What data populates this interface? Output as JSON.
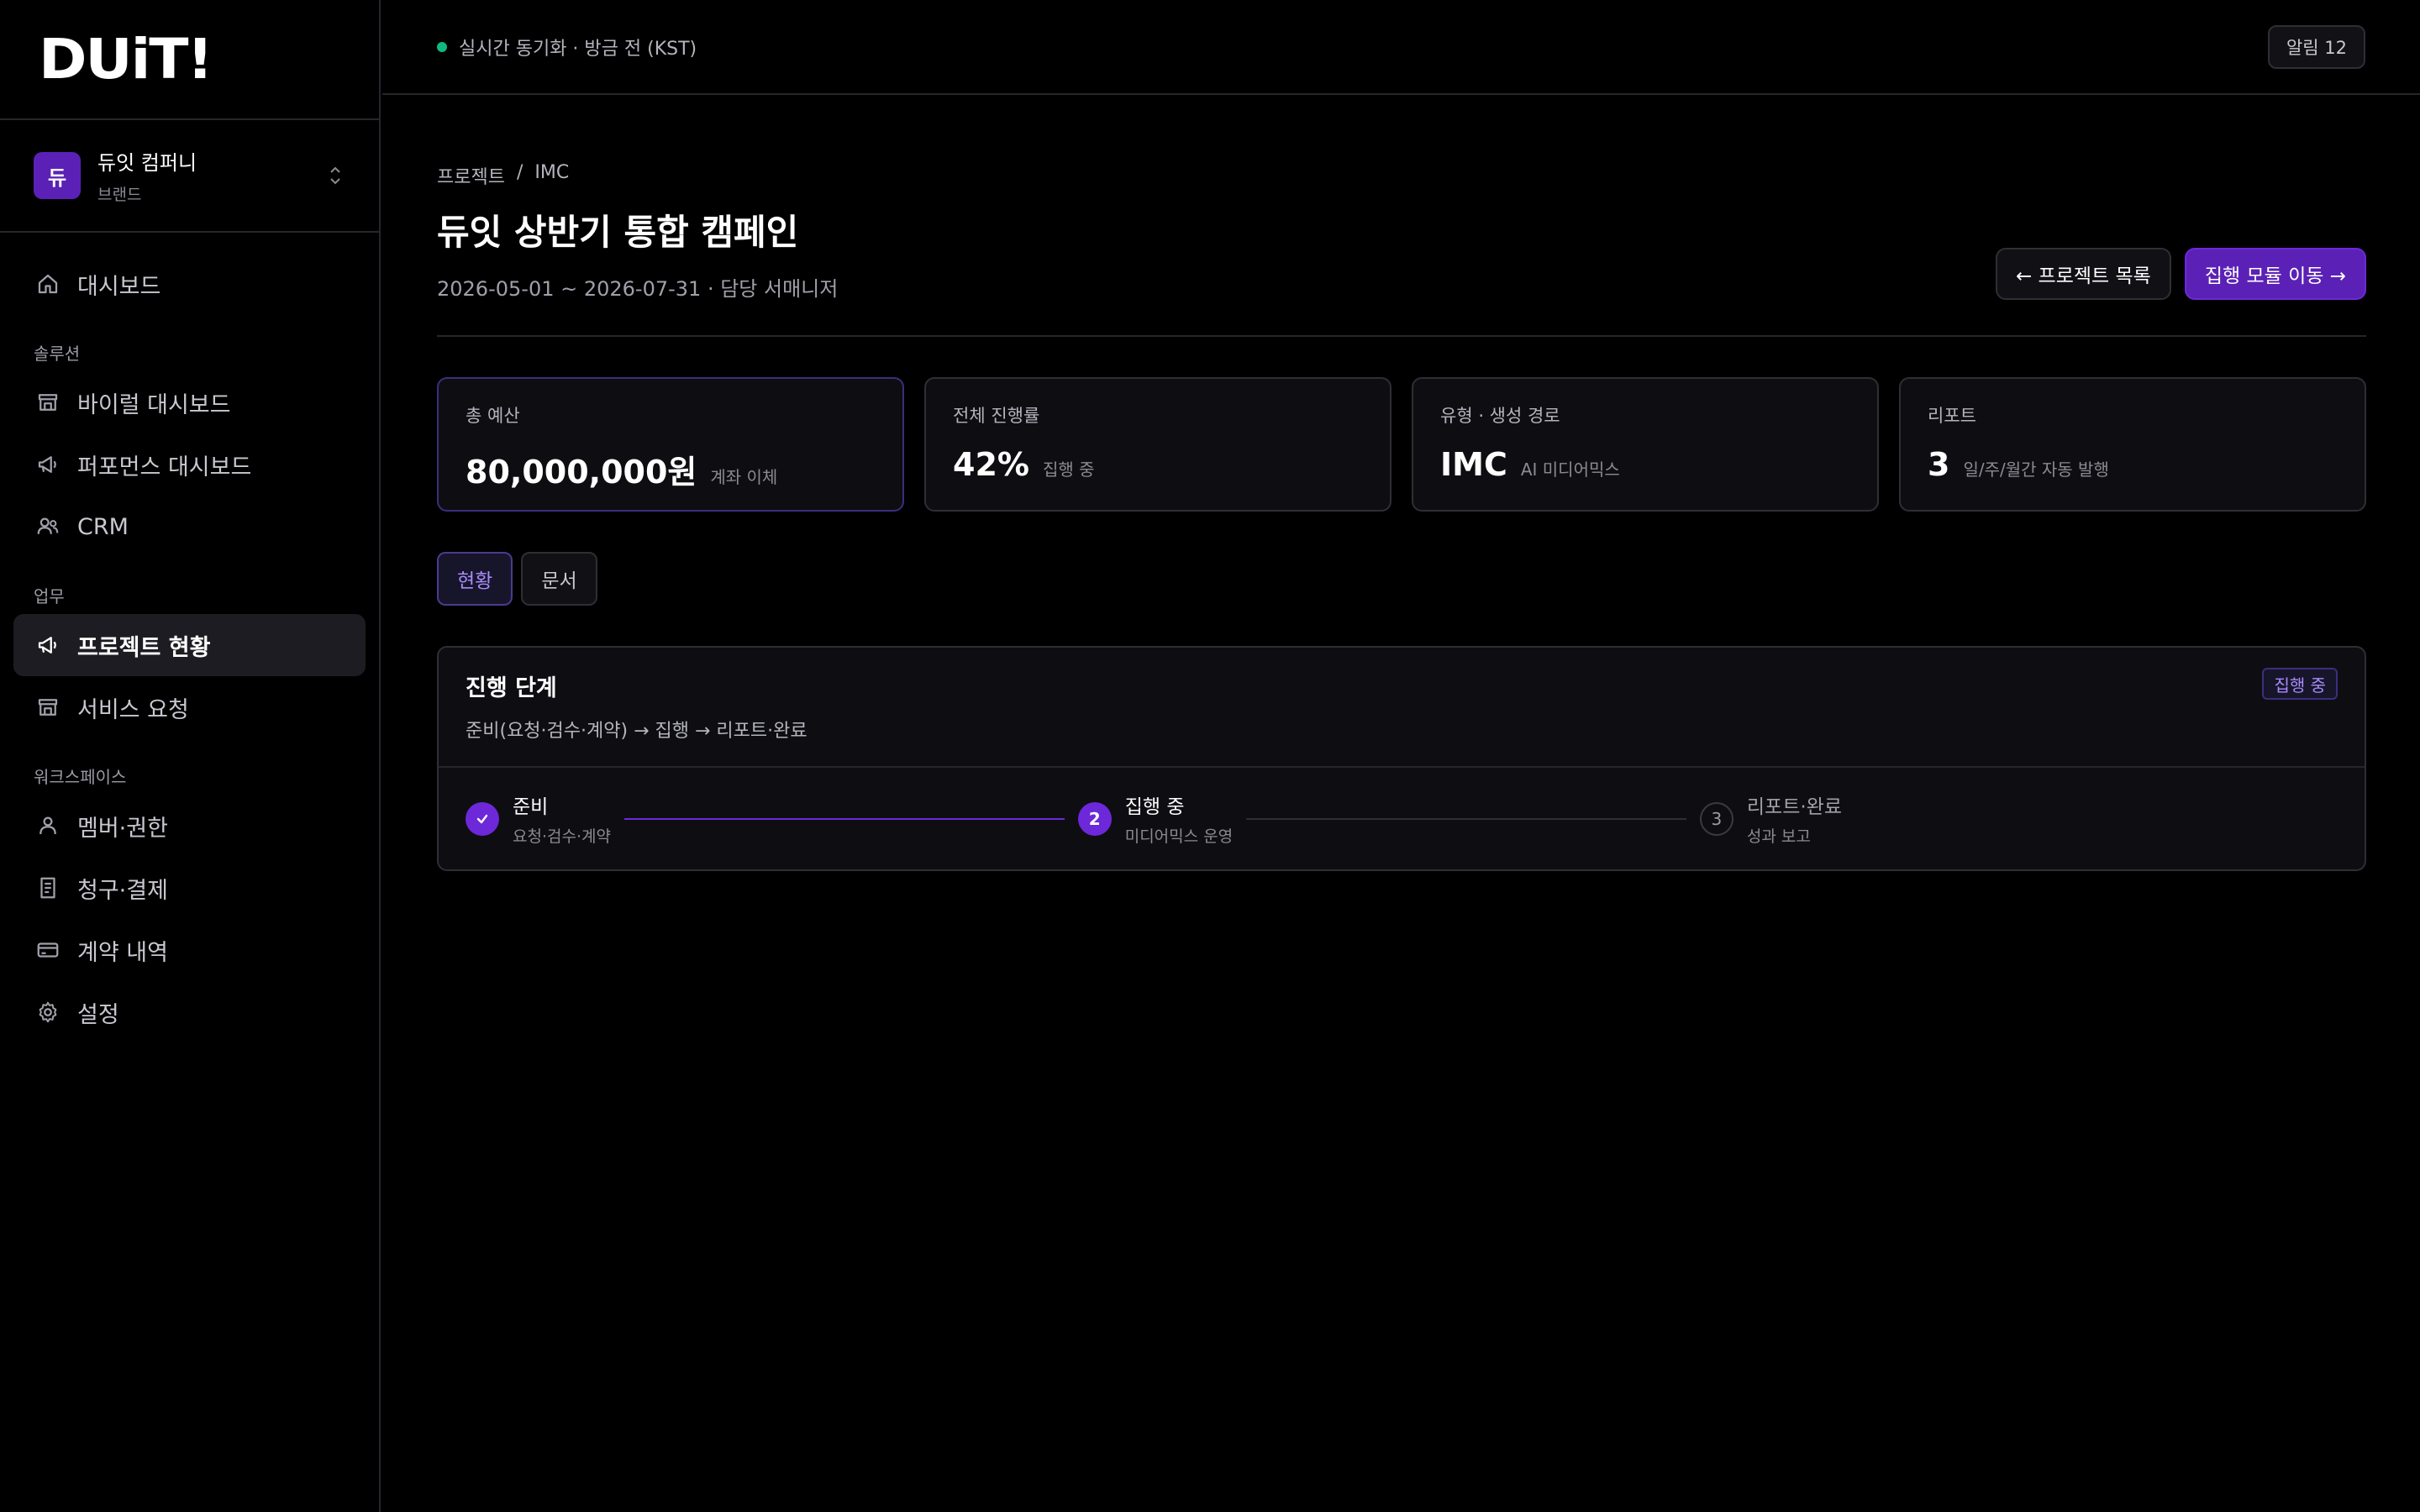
{
  "brand": {
    "logo": "DUiT!"
  },
  "company": {
    "avatar": "듀",
    "name": "듀잇 컴퍼니",
    "type": "브랜드"
  },
  "sidebar": {
    "dashboard": "대시보드",
    "sections": {
      "solution": "솔루션",
      "work": "업무",
      "workspace": "워크스페이스"
    },
    "items": {
      "viral": "바이럴 대시보드",
      "performance": "퍼포먼스 대시보드",
      "crm": "CRM",
      "project_status": "프로젝트 현황",
      "service_request": "서비스 요청",
      "members": "멤버·권한",
      "billing": "청구·결제",
      "contracts": "계약 내역",
      "settings": "설정"
    }
  },
  "topbar": {
    "sync_status": "실시간 동기화 · 방금 전 (KST)",
    "alerts": "알림 12",
    "status_color": "#10b981"
  },
  "breadcrumb": {
    "root": "프로젝트",
    "sep": "/",
    "current": "IMC"
  },
  "header": {
    "title": "듀잇 상반기 통합 캠페인",
    "subtitle": "2026-05-01 ~ 2026-07-31 · 담당 서매니저",
    "back_button": "← 프로젝트 목록",
    "primary_button": "집행 모듈 이동 →"
  },
  "cards": [
    {
      "label": "총 예산",
      "value": "80,000,000원",
      "note": "계좌 이체"
    },
    {
      "label": "전체 진행률",
      "value": "42%",
      "note": "집행 중"
    },
    {
      "label": "유형 · 생성 경로",
      "value": "IMC",
      "note": "AI 미디어믹스"
    },
    {
      "label": "리포트",
      "value": "3",
      "note": "일/주/월간 자동 발행"
    }
  ],
  "tabs": {
    "status": "현황",
    "documents": "문서"
  },
  "progress": {
    "title": "진행 단계",
    "subtitle": "준비(요청·검수·계약) → 집행 → 리포트·완료",
    "badge": "집행 중",
    "steps": [
      {
        "label": "준비",
        "desc": "요청·검수·계약",
        "state": "done"
      },
      {
        "label": "집행 중",
        "desc": "미디어믹스 운영",
        "number": "2",
        "state": "current"
      },
      {
        "label": "리포트·완료",
        "desc": "성과 보고",
        "number": "3",
        "state": "todo"
      }
    ]
  },
  "colors": {
    "accent": "#6d28d9",
    "accent_text": "#a78bfa"
  }
}
